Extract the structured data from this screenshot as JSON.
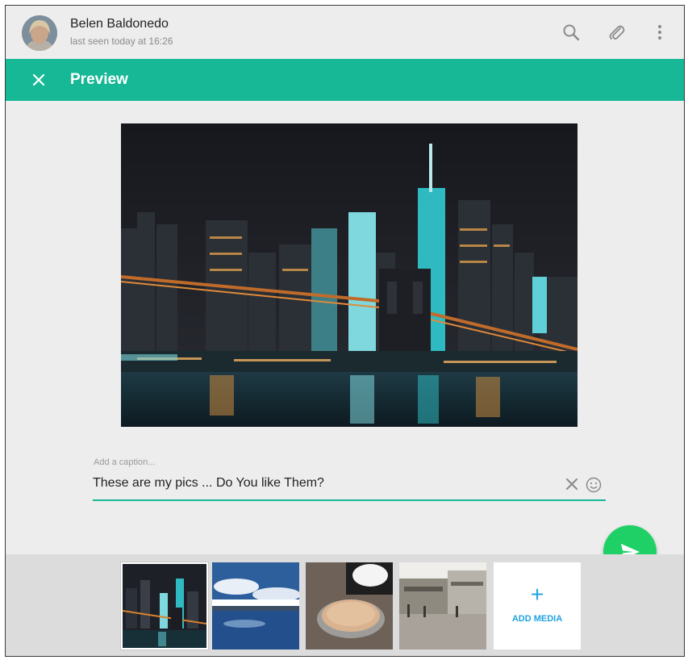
{
  "header": {
    "contact_name": "Belen Baldonedo",
    "status": "last seen today at 16:26",
    "icons": [
      "search-icon",
      "attach-icon",
      "more-vertical-icon"
    ]
  },
  "preview_bar": {
    "title": "Preview",
    "close_icon": "close-icon",
    "color": "#17b896"
  },
  "caption": {
    "placeholder": "Add a caption...",
    "value": "These are my pics ... Do You like Them?",
    "icons": [
      "clear-icon",
      "emoji-icon"
    ]
  },
  "send": {
    "icon": "send-icon",
    "color": "#1fd066"
  },
  "thumbnails": {
    "items": [
      "city-night",
      "lake-sky",
      "compact-powder",
      "street-scene"
    ],
    "selected_index": 0,
    "add_media_label": "ADD MEDIA"
  },
  "colors": {
    "accent": "#17b896",
    "link_blue": "#1fa3e0"
  }
}
